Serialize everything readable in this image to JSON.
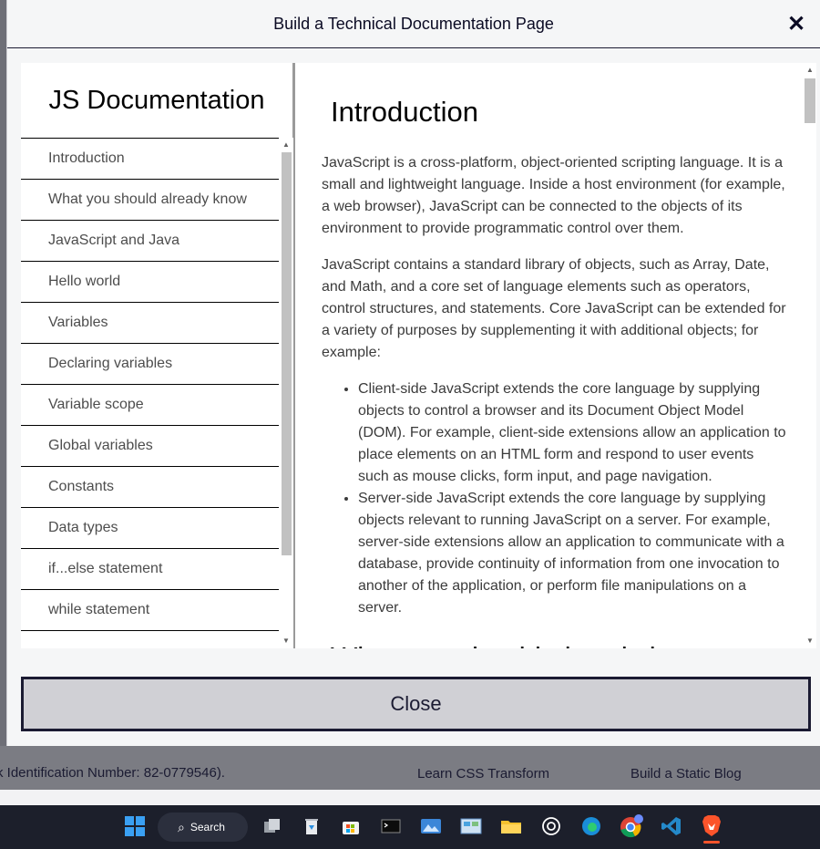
{
  "modal": {
    "title": "Build a Technical Documentation Page",
    "close_button": "Close"
  },
  "nav": {
    "title": "JS Documentation",
    "items": [
      "Introduction",
      "What you should already know",
      "JavaScript and Java",
      "Hello world",
      "Variables",
      "Declaring variables",
      "Variable scope",
      "Global variables",
      "Constants",
      "Data types",
      "if...else statement",
      "while statement"
    ]
  },
  "main": {
    "heading": "Introduction",
    "p1": "JavaScript is a cross-platform, object-oriented scripting language. It is a small and lightweight language. Inside a host environment (for example, a web browser), JavaScript can be connected to the objects of its environment to provide programmatic control over them.",
    "p2": "JavaScript contains a standard library of objects, such as Array, Date, and Math, and a core set of language elements such as operators, control structures, and statements. Core JavaScript can be extended for a variety of purposes by supplementing it with additional objects; for example:",
    "bullets": [
      "Client-side JavaScript extends the core language by supplying objects to control a browser and its Document Object Model (DOM). For example, client-side extensions allow an application to place elements on an HTML form and respond to user events such as mouse clicks, form input, and page navigation.",
      "Server-side JavaScript extends the core language by supplying objects relevant to running JavaScript on a server. For example, server-side extensions allow an application to communicate with a database, provide continuity of information from one invocation to another of the application, or perform file manipulations on a server."
    ],
    "next_heading": "What you should already know"
  },
  "background": {
    "left_text": "k Identification Number: 82-0779546).",
    "link1": "Learn CSS Transform",
    "link2": "Build a Static Blog"
  },
  "taskbar": {
    "search_label": "Search"
  }
}
